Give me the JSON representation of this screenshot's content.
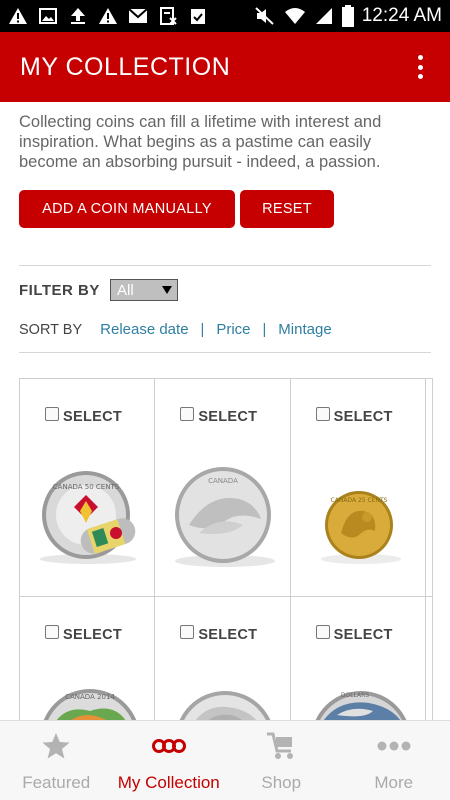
{
  "status_bar": {
    "time": "12:24 AM"
  },
  "app_bar": {
    "title": "MY COLLECTION",
    "menu_icon": "overflow-menu-icon"
  },
  "intro": "Collecting coins can fill a lifetime with interest and inspiration. What begins as a pastime can easily become an absorbing pursuit - indeed, a passion.",
  "buttons": {
    "add_coin": "ADD A COIN MANUALLY",
    "reset": "RESET"
  },
  "filter": {
    "label": "FILTER BY",
    "selected": "All"
  },
  "sort": {
    "label": "SORT BY",
    "options": [
      "Release date",
      "Price",
      "Mintage"
    ]
  },
  "coins": [
    {
      "select_label": "SELECT",
      "selected": false,
      "image_text": "CANADA 50 CENTS"
    },
    {
      "select_label": "SELECT",
      "selected": false,
      "image_text": "CANADA"
    },
    {
      "select_label": "SELECT",
      "selected": false,
      "image_text": "CANADA 25 CENTS"
    },
    {
      "select_label": "SELECT",
      "selected": false,
      "image_text": "CANADA 2014"
    },
    {
      "select_label": "SELECT",
      "selected": false,
      "image_text": ""
    },
    {
      "select_label": "SELECT",
      "selected": false,
      "image_text": "DOLLARS"
    }
  ],
  "bottom_nav": [
    {
      "label": "Featured",
      "icon": "star-icon",
      "active": false
    },
    {
      "label": "My Collection",
      "icon": "collection-icon",
      "active": true
    },
    {
      "label": "Shop",
      "icon": "cart-icon",
      "active": false
    },
    {
      "label": "More",
      "icon": "more-dots-icon",
      "active": false
    }
  ],
  "colors": {
    "brand_red": "#c60000",
    "link_blue": "#2f7fa3"
  }
}
